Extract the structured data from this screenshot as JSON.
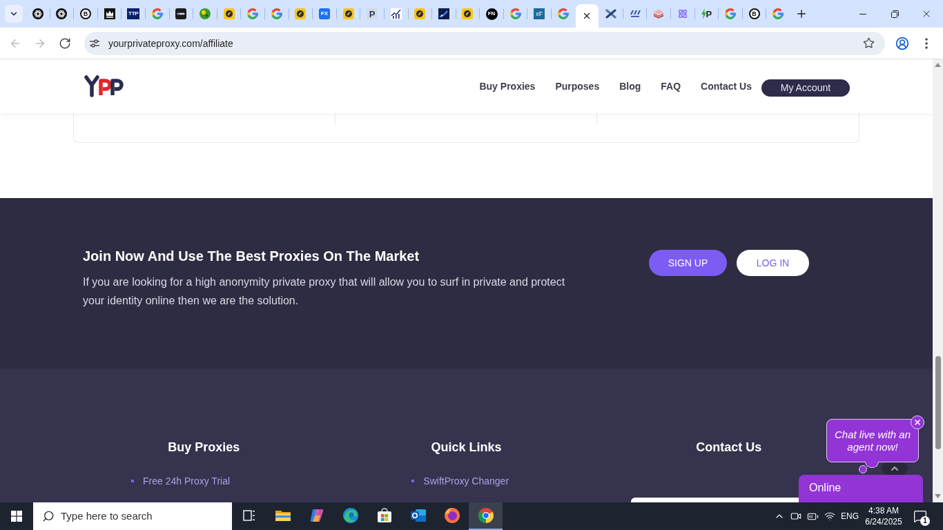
{
  "browser": {
    "tabs": [
      {
        "kind": "spiral",
        "selected": false
      },
      {
        "kind": "spiral",
        "selected": false
      },
      {
        "kind": "b-search",
        "text": "B",
        "selected": false
      },
      {
        "kind": "crown",
        "selected": false
      },
      {
        "kind": "ttp",
        "text": "TTP",
        "selected": false
      },
      {
        "kind": "g",
        "selected": false
      },
      {
        "kind": "dark-tile",
        "selected": false
      },
      {
        "kind": "green-ball",
        "selected": false
      },
      {
        "kind": "bird",
        "selected": false
      },
      {
        "kind": "g",
        "selected": false
      },
      {
        "kind": "g",
        "selected": false
      },
      {
        "kind": "bird",
        "selected": false
      },
      {
        "kind": "fx",
        "text": "FX",
        "selected": false
      },
      {
        "kind": "bird",
        "selected": false
      },
      {
        "kind": "p",
        "text": "P",
        "selected": false
      },
      {
        "kind": "chart-est",
        "selected": false
      },
      {
        "kind": "bird",
        "selected": false
      },
      {
        "kind": "navy-chart",
        "selected": false
      },
      {
        "kind": "bird",
        "selected": false
      },
      {
        "kind": "fn",
        "text": "FN",
        "selected": false
      },
      {
        "kind": "g",
        "selected": false
      },
      {
        "kind": "xf",
        "text": "xF",
        "selected": false
      },
      {
        "kind": "g",
        "selected": false
      },
      {
        "selected": true
      },
      {
        "kind": "x-shape",
        "selected": false
      },
      {
        "kind": "abc",
        "selected": false
      },
      {
        "kind": "layers",
        "selected": false
      },
      {
        "kind": "atom",
        "selected": false
      },
      {
        "kind": "bolt-p",
        "text": "P",
        "selected": false
      },
      {
        "kind": "g",
        "selected": false
      },
      {
        "kind": "b-search",
        "text": "B",
        "selected": false
      },
      {
        "kind": "g",
        "selected": false
      }
    ],
    "nav_buttons": [
      {
        "kind": "back",
        "disabled": true
      },
      {
        "kind": "forward",
        "disabled": true
      },
      {
        "kind": "reload",
        "disabled": false
      }
    ],
    "url": "yourprivateproxy.com/affiliate"
  },
  "site_header": {
    "nav": [
      "Buy Proxies",
      "Purposes",
      "Blog",
      "FAQ",
      "Contact Us"
    ],
    "account_button": "My Account"
  },
  "cta": {
    "heading": "Join Now And Use The Best Proxies On The Market",
    "text": "If you are looking for a high anonymity private proxy that will allow you to surf in private and protect your identity online then we are the solution.",
    "buttons": [
      {
        "label": "SIGN UP",
        "kind": "primary"
      },
      {
        "label": "LOG IN",
        "kind": "outline"
      }
    ]
  },
  "footer": {
    "columns": [
      {
        "heading": "Buy Proxies",
        "links": [
          "Free 24h Proxy Trial"
        ]
      },
      {
        "heading": "Quick Links",
        "links": [
          "SwiftProxy Changer"
        ]
      },
      {
        "heading": "Contact Us"
      }
    ]
  },
  "chat": {
    "prompt": "Chat live with an agent now!",
    "status": "Online"
  },
  "taskbar": {
    "search_placeholder": "Type here to search",
    "apps": [
      {
        "kind": "task-view",
        "selected": false
      },
      {
        "kind": "file-explorer",
        "selected": false
      },
      {
        "kind": "copilot",
        "selected": false
      },
      {
        "kind": "edge",
        "selected": false
      },
      {
        "kind": "store",
        "selected": false
      },
      {
        "kind": "outlook",
        "selected": false
      },
      {
        "kind": "firefox",
        "selected": false
      },
      {
        "kind": "chrome",
        "selected": true
      }
    ],
    "language": "ENG",
    "time": "4:38 AM",
    "date": "6/24/2025",
    "notifications": "1"
  }
}
